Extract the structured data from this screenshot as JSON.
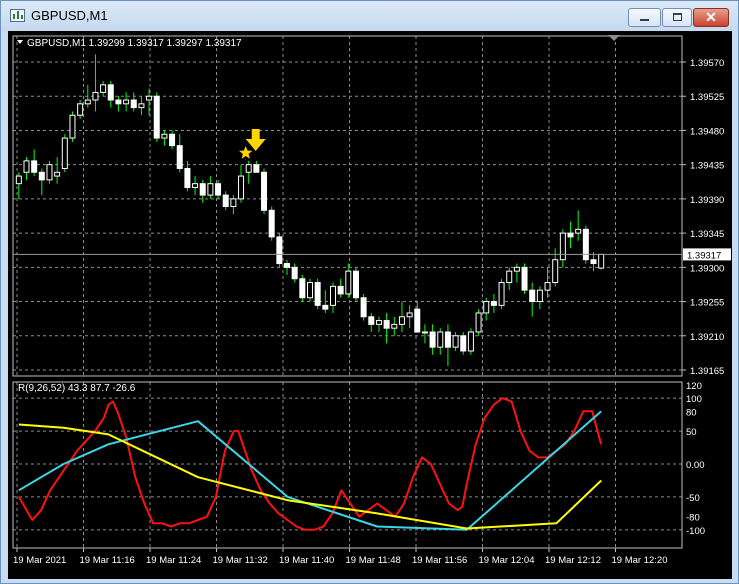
{
  "window": {
    "title": "GBPUSD,M1",
    "minimize_glyph": "minimize",
    "maximize_glyph": "maximize",
    "close_glyph": "✕"
  },
  "chart": {
    "symbol_line": "GBPUSD,M1  1.39299 1.39317 1.39297 1.39317",
    "price_ticks": [
      "1.39570",
      "1.39525",
      "1.39480",
      "1.39435",
      "1.39390",
      "1.39345",
      "1.39300",
      "1.39255",
      "1.39210",
      "1.39165"
    ],
    "current_price": "1.39317",
    "time_ticks": [
      "19 Mar 2021",
      "19 Mar 11:16",
      "19 Mar 11:24",
      "19 Mar 11:32",
      "19 Mar 11:40",
      "19 Mar 11:48",
      "19 Mar 11:56",
      "19 Mar 12:04",
      "19 Mar 12:12",
      "19 Mar 12:20"
    ],
    "indicator_label": "R(9,26,52) 43.3 87.7 -26.6",
    "indicator_ticks": [
      "120",
      "100",
      "80",
      "50",
      "0.00",
      "-50",
      "-80",
      "-100"
    ],
    "colors": {
      "background": "#000000",
      "grid": "#8c8c8c",
      "bull_candle": "#ffffff",
      "bear_candle": "#ffffff",
      "wick": "#00ff00",
      "fast_line": "#ff1010",
      "mid_line": "#38d8e8",
      "slow_line": "#ffff00",
      "arrow": "#ffd500"
    },
    "chart_data": {
      "type": "candlestick",
      "price_range": [
        1.39165,
        1.3957
      ],
      "candles": [
        [
          1.3941,
          1.39425,
          1.3939,
          1.3942
        ],
        [
          1.39425,
          1.39445,
          1.39415,
          1.3944
        ],
        [
          1.3944,
          1.39455,
          1.3942,
          1.39425
        ],
        [
          1.39425,
          1.3943,
          1.39395,
          1.39415
        ],
        [
          1.39415,
          1.3944,
          1.3941,
          1.39435
        ],
        [
          1.3942,
          1.39445,
          1.3941,
          1.39425
        ],
        [
          1.3943,
          1.39475,
          1.39425,
          1.3947
        ],
        [
          1.3947,
          1.39505,
          1.39465,
          1.395
        ],
        [
          1.395,
          1.3952,
          1.39495,
          1.39515
        ],
        [
          1.39515,
          1.3954,
          1.3951,
          1.3952
        ],
        [
          1.3952,
          1.3958,
          1.39505,
          1.3953
        ],
        [
          1.3953,
          1.39545,
          1.39525,
          1.3954
        ],
        [
          1.3954,
          1.39545,
          1.3951,
          1.3952
        ],
        [
          1.3952,
          1.39525,
          1.39505,
          1.39515
        ],
        [
          1.39515,
          1.3953,
          1.39505,
          1.3952
        ],
        [
          1.3952,
          1.3953,
          1.39505,
          1.3951
        ],
        [
          1.3951,
          1.39525,
          1.395,
          1.39515
        ],
        [
          1.3952,
          1.39535,
          1.395,
          1.39525
        ],
        [
          1.39525,
          1.3953,
          1.39465,
          1.3947
        ],
        [
          1.3947,
          1.3948,
          1.3946,
          1.39475
        ],
        [
          1.39475,
          1.3948,
          1.39455,
          1.3946
        ],
        [
          1.3946,
          1.39475,
          1.39425,
          1.3943
        ],
        [
          1.3943,
          1.3944,
          1.394,
          1.39405
        ],
        [
          1.39405,
          1.3942,
          1.39395,
          1.3941
        ],
        [
          1.3941,
          1.39415,
          1.39385,
          1.39395
        ],
        [
          1.39395,
          1.3942,
          1.3939,
          1.3941
        ],
        [
          1.3941,
          1.39415,
          1.3939,
          1.39395
        ],
        [
          1.39395,
          1.394,
          1.39375,
          1.3938
        ],
        [
          1.3938,
          1.39395,
          1.3937,
          1.3939
        ],
        [
          1.3939,
          1.39435,
          1.39385,
          1.3942
        ],
        [
          1.39425,
          1.3944,
          1.3941,
          1.39435
        ],
        [
          1.39435,
          1.3944,
          1.39425,
          1.39425
        ],
        [
          1.39425,
          1.3943,
          1.3937,
          1.39375
        ],
        [
          1.39375,
          1.3938,
          1.39335,
          1.3934
        ],
        [
          1.3934,
          1.39345,
          1.393,
          1.39305
        ],
        [
          1.39305,
          1.3931,
          1.3929,
          1.393
        ],
        [
          1.393,
          1.39305,
          1.3928,
          1.39285
        ],
        [
          1.39285,
          1.3929,
          1.39255,
          1.3926
        ],
        [
          1.3926,
          1.39285,
          1.39255,
          1.3928
        ],
        [
          1.3928,
          1.39285,
          1.39245,
          1.3925
        ],
        [
          1.3925,
          1.3927,
          1.3924,
          1.39245
        ],
        [
          1.3925,
          1.3928,
          1.3924,
          1.39275
        ],
        [
          1.39275,
          1.39285,
          1.3926,
          1.39265
        ],
        [
          1.39265,
          1.39305,
          1.3926,
          1.39295
        ],
        [
          1.39295,
          1.393,
          1.39255,
          1.3926
        ],
        [
          1.3926,
          1.39265,
          1.3923,
          1.39235
        ],
        [
          1.39235,
          1.3924,
          1.39215,
          1.39225
        ],
        [
          1.39225,
          1.39235,
          1.39215,
          1.3923
        ],
        [
          1.3923,
          1.3924,
          1.392,
          1.3922
        ],
        [
          1.3922,
          1.39235,
          1.3921,
          1.39225
        ],
        [
          1.39225,
          1.39255,
          1.39215,
          1.39235
        ],
        [
          1.39235,
          1.3925,
          1.3922,
          1.3924
        ],
        [
          1.39245,
          1.39255,
          1.39215,
          1.39215
        ],
        [
          1.39215,
          1.39225,
          1.392,
          1.39215
        ],
        [
          1.39215,
          1.39225,
          1.39185,
          1.39195
        ],
        [
          1.39195,
          1.3922,
          1.39185,
          1.39215
        ],
        [
          1.39215,
          1.39225,
          1.3917,
          1.39195
        ],
        [
          1.39195,
          1.39215,
          1.3919,
          1.3921
        ],
        [
          1.3921,
          1.39215,
          1.39185,
          1.3919
        ],
        [
          1.3919,
          1.3922,
          1.39185,
          1.39215
        ],
        [
          1.39215,
          1.39245,
          1.3921,
          1.3924
        ],
        [
          1.3924,
          1.3926,
          1.3923,
          1.39255
        ],
        [
          1.39255,
          1.39265,
          1.3924,
          1.3925
        ],
        [
          1.3925,
          1.39285,
          1.39245,
          1.3928
        ],
        [
          1.3928,
          1.393,
          1.3927,
          1.39295
        ],
        [
          1.39295,
          1.39305,
          1.3928,
          1.393
        ],
        [
          1.393,
          1.39305,
          1.39265,
          1.3927
        ],
        [
          1.3927,
          1.3928,
          1.39235,
          1.39255
        ],
        [
          1.39255,
          1.39275,
          1.39245,
          1.3927
        ],
        [
          1.3927,
          1.393,
          1.3926,
          1.3928
        ],
        [
          1.3928,
          1.39325,
          1.39275,
          1.3931
        ],
        [
          1.3931,
          1.3935,
          1.393,
          1.39345
        ],
        [
          1.39345,
          1.3936,
          1.39325,
          1.3934
        ],
        [
          1.39345,
          1.39375,
          1.39335,
          1.3935
        ],
        [
          1.3935,
          1.39355,
          1.39305,
          1.3931
        ],
        [
          1.3931,
          1.3932,
          1.39295,
          1.39305
        ],
        [
          1.39299,
          1.39317,
          1.39297,
          1.39317
        ]
      ],
      "indicator_range": [
        -120,
        120
      ],
      "series": [
        {
          "x": [
            0,
            3,
            5,
            7,
            9,
            11,
            13,
            15,
            17,
            19,
            20,
            21,
            22,
            24,
            26,
            28,
            30,
            32,
            34,
            36,
            38,
            40,
            42,
            44,
            46,
            48,
            49,
            50,
            52,
            54,
            56,
            58,
            60,
            62,
            64,
            66,
            68,
            70,
            72,
            74,
            76,
            78,
            80,
            82,
            84,
            86,
            88,
            90,
            92,
            94,
            96,
            98,
            99,
            100,
            102,
            104,
            106,
            108,
            110,
            112,
            114,
            116,
            118,
            120,
            122,
            124,
            126,
            128,
            130
          ],
          "values": [
            -50,
            -85,
            -70,
            -40,
            -20,
            0,
            20,
            35,
            50,
            70,
            90,
            95,
            80,
            40,
            -20,
            -60,
            -90,
            -90,
            -95,
            -90,
            -90,
            -85,
            -80,
            -50,
            20,
            50,
            50,
            30,
            -10,
            -40,
            -60,
            -75,
            -85,
            -95,
            -100,
            -100,
            -95,
            -75,
            -40,
            -60,
            -80,
            -70,
            -60,
            -70,
            -80,
            -60,
            -20,
            10,
            0,
            -30,
            -60,
            -70,
            -65,
            -30,
            30,
            70,
            90,
            100,
            95,
            50,
            20,
            10,
            10,
            20,
            30,
            50,
            80,
            80,
            30
          ]
        },
        {
          "x": [
            0,
            10,
            20,
            40,
            60,
            80,
            100,
            120,
            130
          ],
          "values": [
            -40,
            0,
            30,
            65,
            -50,
            -95,
            -100,
            20,
            80
          ]
        },
        {
          "x": [
            0,
            10,
            20,
            40,
            60,
            80,
            100,
            120,
            130
          ],
          "values": [
            60,
            55,
            45,
            -20,
            -55,
            -75,
            -98,
            -90,
            -25
          ]
        }
      ]
    }
  }
}
